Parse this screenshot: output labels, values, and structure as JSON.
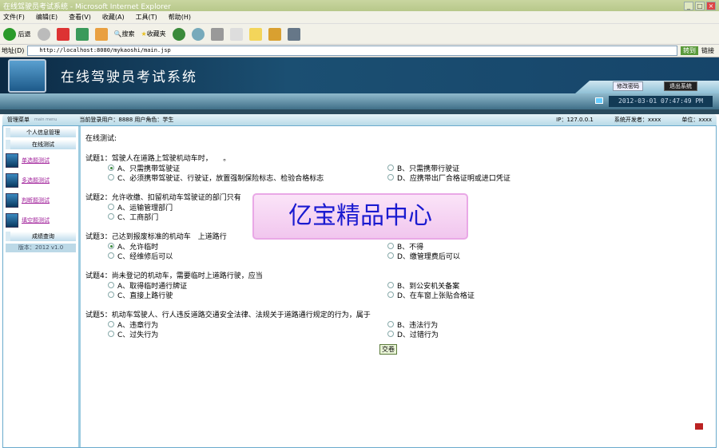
{
  "window": {
    "title": "在线驾驶员考试系统 - Microsoft Internet Explorer"
  },
  "menu": [
    "文件(F)",
    "编辑(E)",
    "查看(V)",
    "收藏(A)",
    "工具(T)",
    "帮助(H)"
  ],
  "toolbar": {
    "back": "后退",
    "search": "搜索",
    "favorites": "收藏夹"
  },
  "address": {
    "label": "地址(D)",
    "url": "http://localhost:8080/mykaoshi/main.jsp",
    "go": "转到",
    "links": "链接"
  },
  "header": {
    "title": "在线驾驶员考试系统",
    "change_password": "修改密码",
    "logout": "退出系统",
    "datetime": "2012-03-01 07:47:49 PM"
  },
  "info": {
    "menu_label": "管理菜单",
    "menu_sub": "main menu",
    "user": "当前登录用户：8888  用户角色：学生",
    "ip": "IP：127.0.0.1",
    "developer": "系统开发者：xxxx",
    "unit": "单位：xxxx"
  },
  "sidebar": {
    "personal": "个人信息管理",
    "online_test": "在线测试",
    "links": [
      "单选题测试",
      "多选题测试",
      "判断题测试",
      "填空题测试"
    ],
    "scores": "成绩查询",
    "version": "版本：2012 v1.0"
  },
  "main": {
    "heading": "在线测试:",
    "submit": "交卷",
    "questions": [
      {
        "title": "试题1：驾驶人在道路上驾驶机动车时，　　。",
        "options": [
          "A、只需携带驾驶证",
          "B、只需携带行驶证",
          "C、必须携带驾驶证、行驶证，放置强制保险标志、检验合格标志",
          "D、应携带出厂合格证明或进口凭证"
        ],
        "selected": 0
      },
      {
        "title": "试题2：允许收缴、扣留机动车驾驶证的部门只有",
        "options": [
          "A、运输管理部门",
          "B、…管理部门",
          "C、工商部门",
          ""
        ],
        "selected": -1
      },
      {
        "title": "试题3：己达到报废标准的机动车　上道路行",
        "options": [
          "A、允许临时",
          "B、不得",
          "C、经维修后可以",
          "D、缴管理费后可以"
        ],
        "selected": 0
      },
      {
        "title": "试题4：尚未登记的机动车，需要临时上道路行驶，应当",
        "options": [
          "A、取得临时通行牌证",
          "B、到公安机关备案",
          "C、直接上路行驶",
          "D、在车窗上张贴合格证"
        ],
        "selected": -1
      },
      {
        "title": "试题5：机动车驾驶人、行人违反道路交通安全法律、法规关于道路通行规定的行为，属于",
        "options": [
          "A、违章行为",
          "B、违法行为",
          "C、过失行为",
          "D、过错行为"
        ],
        "selected": -1
      }
    ]
  },
  "watermark": "亿宝精品中心"
}
